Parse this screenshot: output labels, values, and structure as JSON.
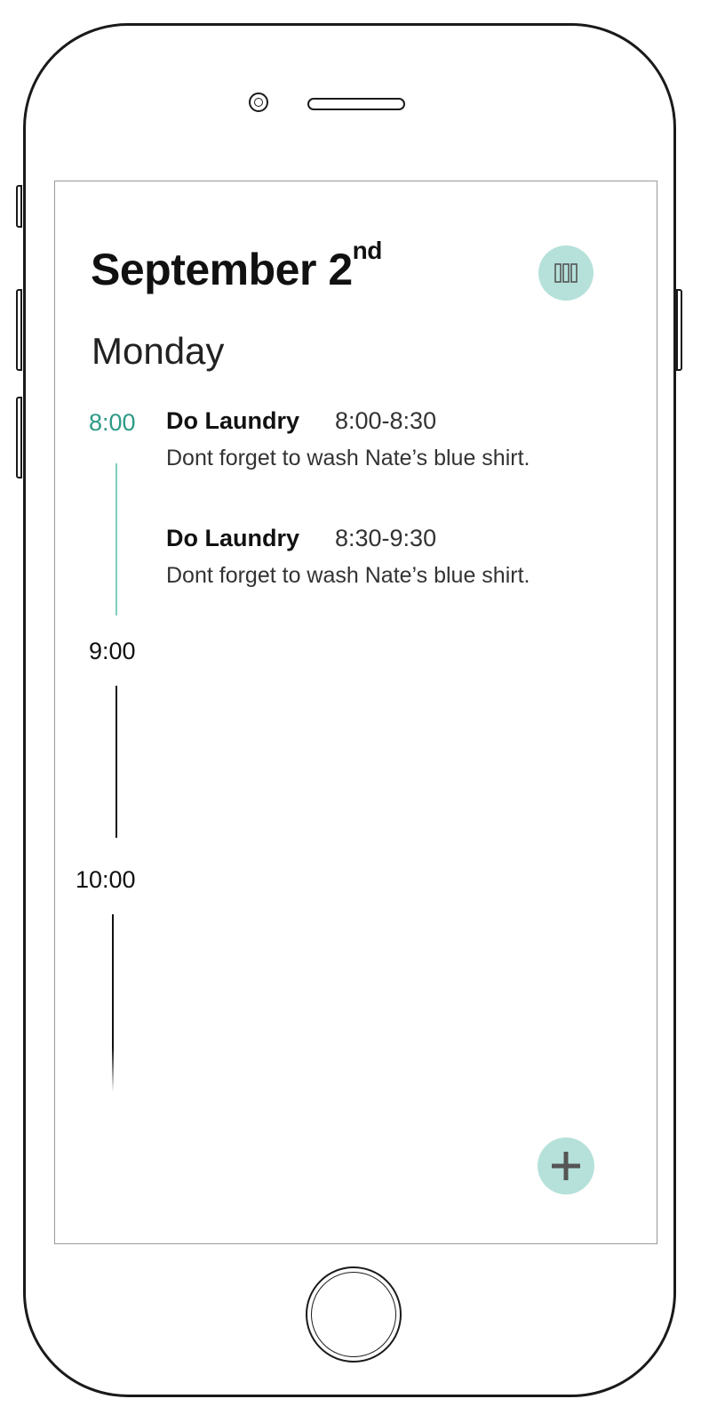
{
  "header": {
    "month_day": "September 2",
    "ordinal_suffix": "nd",
    "weekday": "Monday"
  },
  "toolbar": {
    "menu_icon": "columns-icon",
    "add_icon": "plus-icon"
  },
  "timeline": {
    "hours": [
      "8:00",
      "9:00",
      "10:00"
    ],
    "active_hour": "8:00"
  },
  "events": [
    {
      "title": "Do Laundry",
      "time": "8:00-8:30",
      "note": "Dont forget to wash Nate’s blue shirt."
    },
    {
      "title": "Do Laundry",
      "time": "8:30-9:30",
      "note": "Dont forget to wash Nate’s blue shirt."
    }
  ],
  "colors": {
    "accent": "#2e9a86",
    "accent_light": "#b5e1da",
    "timeline_active": "#7fcdbd"
  }
}
